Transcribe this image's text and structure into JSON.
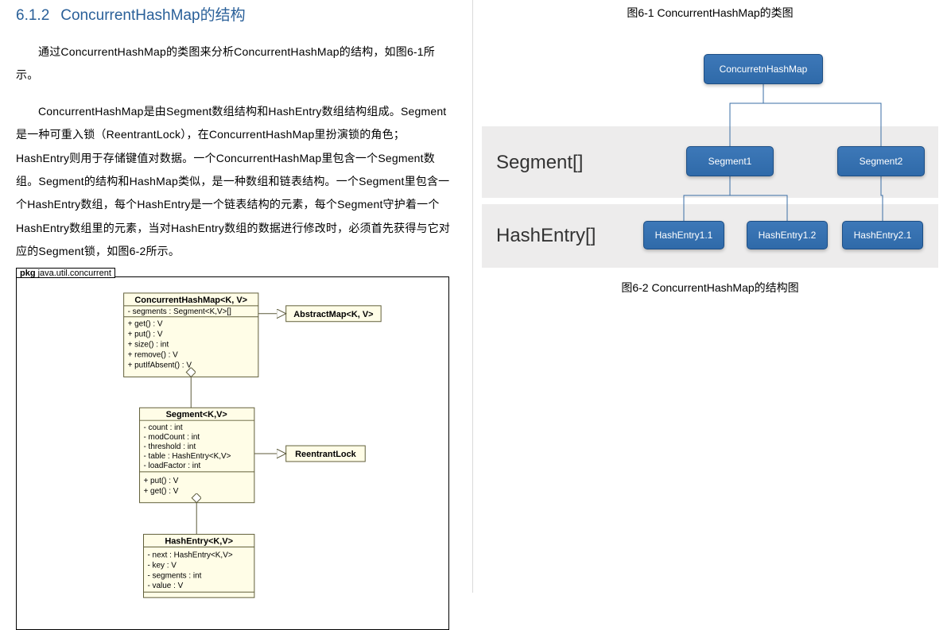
{
  "left": {
    "heading_num": "6.1.2",
    "heading_text": "ConcurrentHashMap的结构",
    "para1": "通过ConcurrentHashMap的类图来分析ConcurrentHashMap的结构，如图6-1所示。",
    "para2": "ConcurrentHashMap是由Segment数组结构和HashEntry数组结构组成。Segment是一种可重入锁（ReentrantLock），在ConcurrentHashMap里扮演锁的角色；HashEntry则用于存储键值对数据。一个ConcurrentHashMap里包含一个Segment数组。Segment的结构和HashMap类似，是一种数组和链表结构。一个Segment里包含一个HashEntry数组，每个HashEntry是一个链表结构的元素，每个Segment守护着一个HashEntry数组里的元素，当对HashEntry数组的数据进行修改时，必须首先获得与它对应的Segment锁，如图6-2所示。",
    "pkg_prefix": "pkg",
    "pkg_name": "java.util.concurrent",
    "uml": {
      "chm": {
        "title": "ConcurrentHashMap<K, V>",
        "fields": [
          "- segments : Segment<K,V>[]"
        ],
        "methods": [
          "+ get() : V",
          "+ put() : V",
          "+ size() : int",
          "+ remove() : V",
          "+ putIfAbsent() : V"
        ]
      },
      "absmap": {
        "title": "AbstractMap<K, V>"
      },
      "seg": {
        "title": "Segment<K,V>",
        "fields": [
          "- count : int",
          "- modCount : int",
          "- threshold : int",
          "- table : HashEntry<K,V>",
          "- loadFactor : int"
        ],
        "methods": [
          "+ put() : V",
          "+ get() : V"
        ]
      },
      "rlock": {
        "title": "ReentrantLock"
      },
      "he": {
        "title": "HashEntry<K,V>",
        "fields": [
          "- next : HashEntry<K,V>",
          "- key : V",
          "- segments : int",
          "- value : V"
        ]
      }
    }
  },
  "right": {
    "caption1": "图6-1  ConcurrentHashMap的类图",
    "caption2": "图6-2  ConcurrentHashMap的结构图",
    "band_seg": "Segment[]",
    "band_he": "HashEntry[]",
    "root": "ConcurretnHashMap",
    "seg1": "Segment1",
    "seg2": "Segment2",
    "he11": "HashEntry1.1",
    "he12": "HashEntry1.2",
    "he21": "HashEntry2.1"
  },
  "chart_data": {
    "type": "diagram-tree",
    "title": "ConcurrentHashMap的结构图",
    "root": "ConcurretnHashMap",
    "levels": [
      {
        "label": "Segment[]",
        "nodes": [
          "Segment1",
          "Segment2"
        ]
      },
      {
        "label": "HashEntry[]",
        "nodes": [
          "HashEntry1.1",
          "HashEntry1.2",
          "HashEntry2.1"
        ]
      }
    ],
    "edges": [
      [
        "ConcurretnHashMap",
        "Segment1"
      ],
      [
        "ConcurretnHashMap",
        "Segment2"
      ],
      [
        "Segment1",
        "HashEntry1.1"
      ],
      [
        "Segment1",
        "HashEntry1.2"
      ],
      [
        "Segment2",
        "HashEntry2.1"
      ]
    ]
  }
}
